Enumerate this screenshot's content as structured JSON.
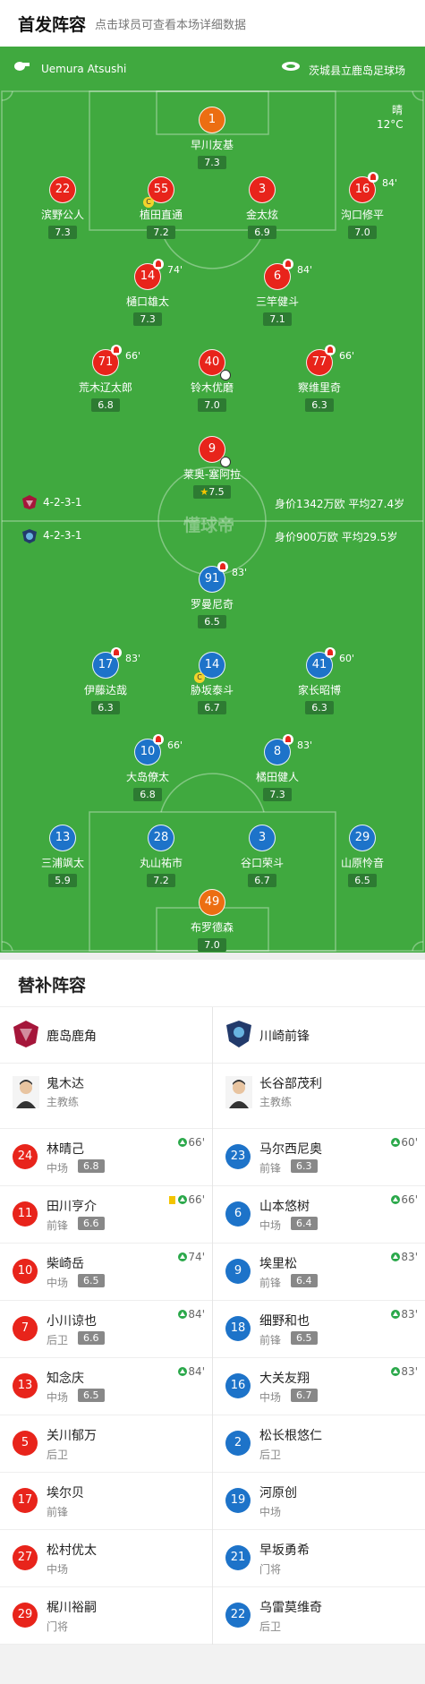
{
  "header": {
    "title": "首发阵容",
    "subtitle": "点击球员可查看本场详细数据"
  },
  "match": {
    "referee": "Uemura Atsushi",
    "stadium": "茨城县立鹿岛足球场",
    "weather": "晴",
    "temperature": "12°C"
  },
  "home": {
    "formation": "4-2-3-1",
    "summary": "身价1342万欧 平均27.4岁"
  },
  "away": {
    "formation": "4-2-3-1",
    "summary": "身价900万欧  平均29.5岁"
  },
  "players": [
    {
      "num": "1",
      "name": "早川友基",
      "rating": "7.3",
      "color": "orange"
    },
    {
      "num": "22",
      "name": "滨野公人",
      "rating": "7.3",
      "color": "red"
    },
    {
      "num": "55",
      "name": "植田直通",
      "rating": "7.2",
      "color": "red",
      "captain": true
    },
    {
      "num": "3",
      "name": "金太炫",
      "rating": "6.9",
      "color": "red"
    },
    {
      "num": "16",
      "name": "沟口修平",
      "rating": "7.0",
      "color": "red",
      "sub": "84'"
    },
    {
      "num": "14",
      "name": "樋口雄太",
      "rating": "7.3",
      "color": "red",
      "sub": "74'"
    },
    {
      "num": "6",
      "name": "三竿健斗",
      "rating": "7.1",
      "color": "red",
      "sub": "84'"
    },
    {
      "num": "71",
      "name": "荒木辽太郎",
      "rating": "6.8",
      "color": "red",
      "sub": "66'"
    },
    {
      "num": "40",
      "name": "铃木优磨",
      "rating": "7.0",
      "color": "red",
      "ball": true
    },
    {
      "num": "77",
      "name": "察维里奇",
      "rating": "6.3",
      "color": "red",
      "sub": "66'"
    },
    {
      "num": "9",
      "name": "莱奥-塞阿拉",
      "rating": "7.5",
      "color": "red",
      "ball": true,
      "star": true
    },
    {
      "num": "91",
      "name": "罗曼尼奇",
      "rating": "6.5",
      "color": "blue",
      "sub": "83'"
    },
    {
      "num": "17",
      "name": "伊藤达哉",
      "rating": "6.3",
      "color": "blue",
      "sub": "83'"
    },
    {
      "num": "14",
      "name": "胁坂泰斗",
      "rating": "6.7",
      "color": "blue",
      "captain": true
    },
    {
      "num": "41",
      "name": "家长昭博",
      "rating": "6.3",
      "color": "blue",
      "sub": "60'"
    },
    {
      "num": "10",
      "name": "大岛僚太",
      "rating": "6.8",
      "color": "blue",
      "sub": "66'"
    },
    {
      "num": "8",
      "name": "橘田健人",
      "rating": "7.3",
      "color": "blue",
      "sub": "83'"
    },
    {
      "num": "13",
      "name": "三浦飒太",
      "rating": "5.9",
      "color": "blue"
    },
    {
      "num": "28",
      "name": "丸山祐市",
      "rating": "7.2",
      "color": "blue"
    },
    {
      "num": "3",
      "name": "谷口荣斗",
      "rating": "6.7",
      "color": "blue"
    },
    {
      "num": "29",
      "name": "山原怜音",
      "rating": "6.5",
      "color": "blue"
    },
    {
      "num": "49",
      "name": "布罗德森",
      "rating": "7.0",
      "color": "orange"
    }
  ],
  "subs": {
    "title": "替补阵容",
    "home": {
      "team": "鹿岛鹿角",
      "coach": "鬼木达",
      "coach_role": "主教练",
      "color": "#e8241b",
      "list": [
        {
          "num": "24",
          "name": "林晴己",
          "pos": "中场",
          "rating": "6.8",
          "in": "66'"
        },
        {
          "num": "11",
          "name": "田川亨介",
          "pos": "前锋",
          "rating": "6.6",
          "in": "66'",
          "yellow": true
        },
        {
          "num": "10",
          "name": "柴崎岳",
          "pos": "中场",
          "rating": "6.5",
          "in": "74'"
        },
        {
          "num": "7",
          "name": "小川谅也",
          "pos": "后卫",
          "rating": "6.6",
          "in": "84'"
        },
        {
          "num": "13",
          "name": "知念庆",
          "pos": "中场",
          "rating": "6.5",
          "in": "84'"
        },
        {
          "num": "5",
          "name": "关川郁万",
          "pos": "后卫"
        },
        {
          "num": "17",
          "name": "埃尔贝",
          "pos": "前锋"
        },
        {
          "num": "27",
          "name": "松村优太",
          "pos": "中场"
        },
        {
          "num": "29",
          "name": "梶川裕嗣",
          "pos": "门将"
        }
      ]
    },
    "away": {
      "team": "川崎前锋",
      "coach": "长谷部茂利",
      "coach_role": "主教练",
      "color": "#1d73c9",
      "list": [
        {
          "num": "23",
          "name": "马尔西尼奥",
          "pos": "前锋",
          "rating": "6.3",
          "in": "60'"
        },
        {
          "num": "6",
          "name": "山本悠树",
          "pos": "中场",
          "rating": "6.4",
          "in": "66'"
        },
        {
          "num": "9",
          "name": "埃里松",
          "pos": "前锋",
          "rating": "6.4",
          "in": "83'"
        },
        {
          "num": "18",
          "name": "细野和也",
          "pos": "前锋",
          "rating": "6.5",
          "in": "83'"
        },
        {
          "num": "16",
          "name": "大关友翔",
          "pos": "中场",
          "rating": "6.7",
          "in": "83'"
        },
        {
          "num": "2",
          "name": "松长根悠仁",
          "pos": "后卫"
        },
        {
          "num": "19",
          "name": "河原创",
          "pos": "中场"
        },
        {
          "num": "21",
          "name": "早坂勇希",
          "pos": "门将"
        },
        {
          "num": "22",
          "name": "乌雷莫维奇",
          "pos": "后卫"
        }
      ]
    }
  }
}
